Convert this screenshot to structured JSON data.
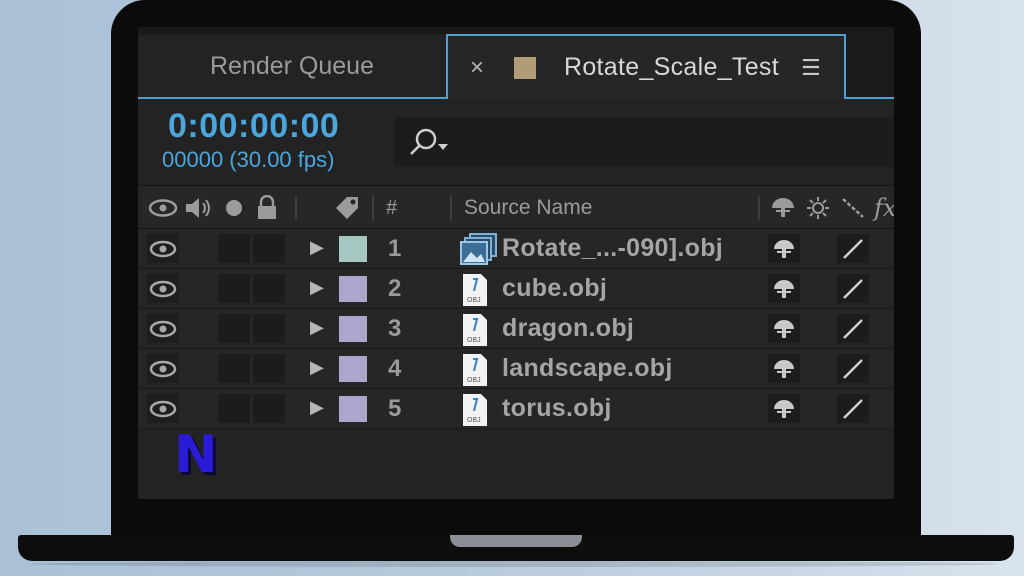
{
  "tabs": {
    "render_queue": "Render Queue",
    "active": {
      "close": "×",
      "label": "Rotate_Scale_Test",
      "menu": "☰",
      "swatch_color": "#b19c78"
    }
  },
  "time": {
    "timecode": "0:00:00:00",
    "frames": "00000 (30.00 fps)"
  },
  "columns": {
    "number": "#",
    "source_name": "Source Name",
    "fx": "fx"
  },
  "layers": [
    {
      "number": "1",
      "name": "Rotate_...-090].obj",
      "color": "#a6c8c2",
      "icon": "image-sequence-icon"
    },
    {
      "number": "2",
      "name": "cube.obj",
      "color": "#aaa6cc",
      "icon": "obj-file-icon"
    },
    {
      "number": "3",
      "name": "dragon.obj",
      "color": "#aaa6cc",
      "icon": "obj-file-icon"
    },
    {
      "number": "4",
      "name": "landscape.obj",
      "color": "#aaa6cc",
      "icon": "obj-file-icon"
    },
    {
      "number": "5",
      "name": "torus.obj",
      "color": "#aaa6cc",
      "icon": "obj-file-icon"
    }
  ],
  "obj_label": "OBJ",
  "watermark": "N",
  "colors": {
    "accent": "#4aa6dc",
    "tab_border": "#4f9fd0"
  }
}
